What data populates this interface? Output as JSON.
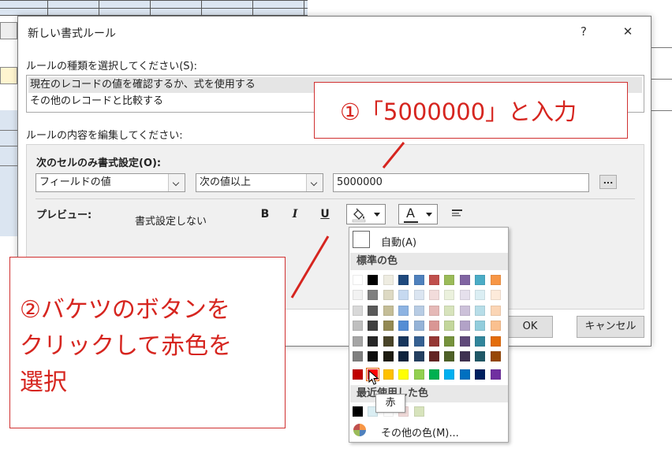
{
  "dialog": {
    "title": "新しい書式ルール",
    "help_label": "?",
    "close_label": "✕"
  },
  "rule_type": {
    "label": "ルールの種類を選択してください(S):",
    "items": [
      "現在のレコードの値を確認するか、式を使用する",
      "その他のレコードと比較する"
    ]
  },
  "rule_edit": {
    "label": "ルールの内容を編集してください:",
    "condition_label": "次のセルのみ書式設定(O):",
    "field_combo": "フィールドの値",
    "operator_combo": "次の値以上",
    "value": "5000000",
    "ellipsis_label": "...",
    "preview_label": "プレビュー:",
    "preview_text": "書式設定しない",
    "bold_label": "B",
    "italic_label": "I",
    "underline_label": "U",
    "font_color_label": "A"
  },
  "buttons": {
    "ok": "OK",
    "cancel": "キャンセル"
  },
  "palette": {
    "auto_label": "自動(A)",
    "standard_header": "標準の色",
    "recent_header": "最近使用した色",
    "more_colors": "その他の色(M)...",
    "tooltip": "赤",
    "columns": [
      "#ffffff",
      "#000000",
      "#eeece1",
      "#1f497d",
      "#4f81bd",
      "#c0504d",
      "#9bbb59",
      "#8064a2",
      "#4bacc6",
      "#f79646"
    ],
    "rows": [
      [
        "#f2f2f2",
        "#7f7f7f",
        "#ddd9c3",
        "#c6d9f0",
        "#dbe5f1",
        "#f2dcdb",
        "#ebf1dd",
        "#e5e0ec",
        "#dbeef3",
        "#fdeada"
      ],
      [
        "#d8d8d8",
        "#595959",
        "#c4bd97",
        "#8db3e2",
        "#b8cce4",
        "#e5b9b7",
        "#d7e3bc",
        "#ccc1d9",
        "#b7dde8",
        "#fbd5b5"
      ],
      [
        "#bfbfbf",
        "#3f3f3f",
        "#938953",
        "#548dd4",
        "#95b3d7",
        "#d99694",
        "#c3d69b",
        "#b2a2c7",
        "#92cddc",
        "#fac08f"
      ],
      [
        "#a5a5a5",
        "#262626",
        "#494429",
        "#17365d",
        "#366092",
        "#953734",
        "#76923c",
        "#5f497a",
        "#31859b",
        "#e36c09"
      ],
      [
        "#7f7f7f",
        "#0c0c0c",
        "#1d1b10",
        "#0f243e",
        "#244061",
        "#632423",
        "#4f6128",
        "#3f3151",
        "#205867",
        "#974806"
      ]
    ],
    "standard": [
      "#c00000",
      "#ff0000",
      "#ffc000",
      "#ffff00",
      "#92d050",
      "#00b050",
      "#00b0f0",
      "#0070c0",
      "#002060",
      "#7030a0"
    ],
    "recent": [
      "#000000",
      "#daeef3",
      "#ffffff",
      "#f2dcdb",
      "#d7e3bc"
    ]
  },
  "annotations": {
    "callout1": "①「5000000」と入力",
    "callout2_line1": "②バケツのボタンを",
    "callout2_line2": "クリックして赤色を",
    "callout2_line3": "選択"
  }
}
